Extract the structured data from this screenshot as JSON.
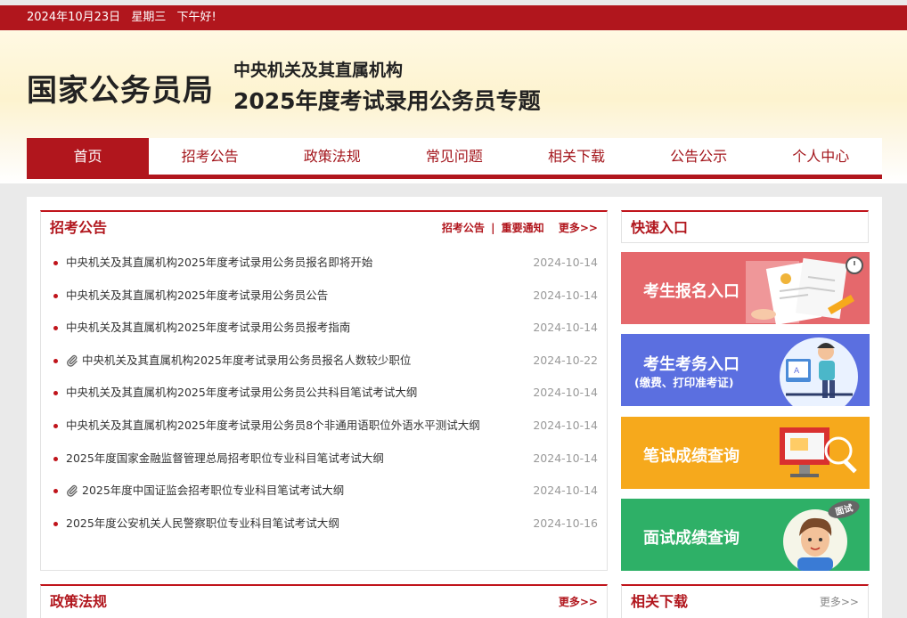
{
  "topbar": {
    "date": "2024年10月23日",
    "weekday": "星期三",
    "greeting": "下午好!"
  },
  "header": {
    "logo": "国家公务员局",
    "subtitle": "中央机关及其直属机构",
    "title": "2025年度考试录用公务员专题"
  },
  "nav": [
    "首页",
    "招考公告",
    "政策法规",
    "常见问题",
    "相关下载",
    "公告公示",
    "个人中心"
  ],
  "news": {
    "title": "招考公告",
    "link1": "招考公告",
    "sep": "|",
    "link2": "重要通知",
    "more": "更多>>",
    "items": [
      {
        "text": "中央机关及其直属机构2025年度考试录用公务员报名即将开始",
        "date": "2024-10-14",
        "attachment": false
      },
      {
        "text": "中央机关及其直属机构2025年度考试录用公务员公告",
        "date": "2024-10-14",
        "attachment": false
      },
      {
        "text": "中央机关及其直属机构2025年度考试录用公务员报考指南",
        "date": "2024-10-14",
        "attachment": false
      },
      {
        "text": "中央机关及其直属机构2025年度考试录用公务员报名人数较少职位",
        "date": "2024-10-22",
        "attachment": true
      },
      {
        "text": "中央机关及其直属机构2025年度考试录用公务员公共科目笔试考试大纲",
        "date": "2024-10-14",
        "attachment": false
      },
      {
        "text": "中央机关及其直属机构2025年度考试录用公务员8个非通用语职位外语水平测试大纲",
        "date": "2024-10-14",
        "attachment": false
      },
      {
        "text": "2025年度国家金融监督管理总局招考职位专业科目笔试考试大纲",
        "date": "2024-10-14",
        "attachment": false
      },
      {
        "text": "2025年度中国证监会招考职位专业科目笔试考试大纲",
        "date": "2024-10-14",
        "attachment": true
      },
      {
        "text": "2025年度公安机关人民警察职位专业科目笔试考试大纲",
        "date": "2024-10-16",
        "attachment": false
      }
    ]
  },
  "quick": {
    "title": "快速入口",
    "banners": [
      {
        "label": "考生报名入口",
        "sub": "",
        "color": "#e5686c"
      },
      {
        "label": "考生考务入口",
        "sub": "(缴费、打印准考证)",
        "color": "#5b6fe0"
      },
      {
        "label": "笔试成绩查询",
        "sub": "",
        "color": "#f6a91c"
      },
      {
        "label": "面试成绩查询",
        "sub": "",
        "color": "#2eb067"
      }
    ],
    "badge": "面试"
  },
  "policy": {
    "title": "政策法规",
    "more": "更多>>"
  },
  "download": {
    "title": "相关下载",
    "more": "更多>>"
  }
}
